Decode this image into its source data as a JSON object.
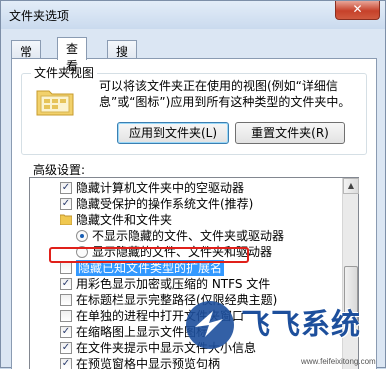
{
  "window": {
    "title": "文件夹选项",
    "close_glyph": "✕"
  },
  "tabs": [
    {
      "label": "常规",
      "active": false
    },
    {
      "label": "查看",
      "active": true
    },
    {
      "label": "搜索",
      "active": false
    }
  ],
  "folder_view": {
    "group_title": "文件夹视图",
    "description": "可以将该文件夹正在使用的视图(例如“详细信息”或“图标”)应用到所有这种类型的文件夹中。",
    "apply_button": "应用到文件夹(L)",
    "reset_button": "重置文件夹(R)"
  },
  "advanced": {
    "label": "高级设置:",
    "items": [
      {
        "type": "checkbox",
        "indent": 1,
        "checked": true,
        "label": "隐藏计算机文件夹中的空驱动器"
      },
      {
        "type": "checkbox",
        "indent": 1,
        "checked": true,
        "label": "隐藏受保护的操作系统文件(推荐)"
      },
      {
        "type": "folder",
        "indent": 1,
        "label": "隐藏文件和文件夹"
      },
      {
        "type": "radio",
        "indent": 2,
        "checked": true,
        "label": "不显示隐藏的文件、文件夹或驱动器"
      },
      {
        "type": "radio",
        "indent": 2,
        "checked": false,
        "label": "显示隐藏的文件、文件夹和驱动器"
      },
      {
        "type": "checkbox",
        "indent": 1,
        "checked": false,
        "selected": true,
        "label": "隐藏已知文件类型的扩展名"
      },
      {
        "type": "checkbox",
        "indent": 1,
        "checked": true,
        "label": "用彩色显示加密或压缩的 NTFS 文件"
      },
      {
        "type": "checkbox",
        "indent": 1,
        "checked": false,
        "label": "在标题栏显示完整路径(仅限经典主题)"
      },
      {
        "type": "checkbox",
        "indent": 1,
        "checked": false,
        "label": "在单独的进程中打开文件夹窗口"
      },
      {
        "type": "checkbox",
        "indent": 1,
        "checked": true,
        "label": "在缩略图上显示文件图标"
      },
      {
        "type": "checkbox",
        "indent": 1,
        "checked": true,
        "label": "在文件夹提示中显示文件大小信息"
      },
      {
        "type": "checkbox",
        "indent": 1,
        "checked": true,
        "label": "在预览窗格中显示预览句柄"
      }
    ]
  },
  "scrollbar": {
    "up_glyph": "▲",
    "down_glyph": "▼"
  },
  "watermark": {
    "brand": "飞飞系统",
    "url": "www.feifeixitong.com"
  },
  "colors": {
    "highlight_box": "#e0201a",
    "selection": "#3399ff",
    "watermark": "#1d4f9c"
  }
}
